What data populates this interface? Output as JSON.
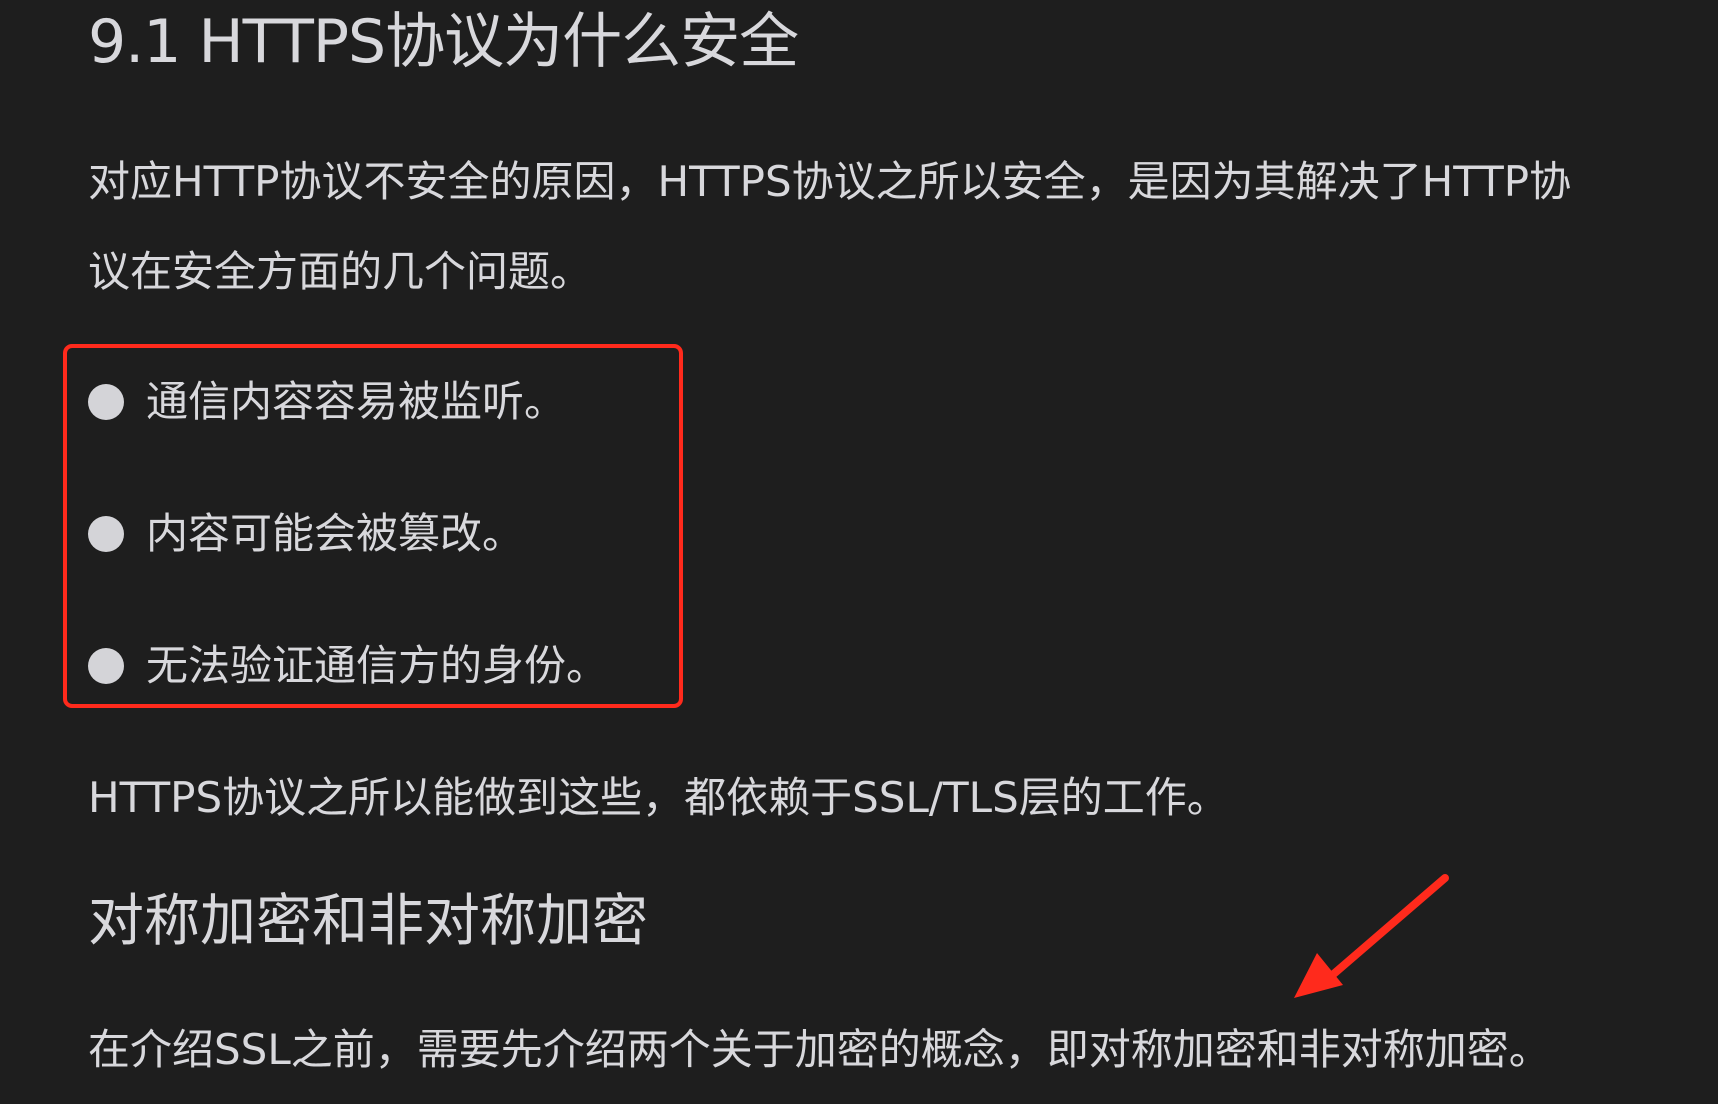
{
  "document": {
    "section_title": "9.1 HTTPS协议为什么安全",
    "intro_line1": "对应HTTP协议不安全的原因，HTTPS协议之所以安全，是因为其解决了HTTP协",
    "intro_line2": "议在安全方面的几个问题。",
    "issues": [
      "通信内容容易被监听。",
      "内容可能会被篡改。",
      "无法验证通信方的身份。"
    ],
    "ssl_note": "HTTPS协议之所以能做到这些，都依赖于SSL/TLS层的工作。",
    "subheading": "对称加密和非对称加密",
    "encryption_intro": "在介绍SSL之前，需要先介绍两个关于加密的概念，即对称加密和非对称加密。"
  },
  "annotations": {
    "box_color": "#ff2a1c",
    "arrow_color": "#ff2a1c"
  }
}
